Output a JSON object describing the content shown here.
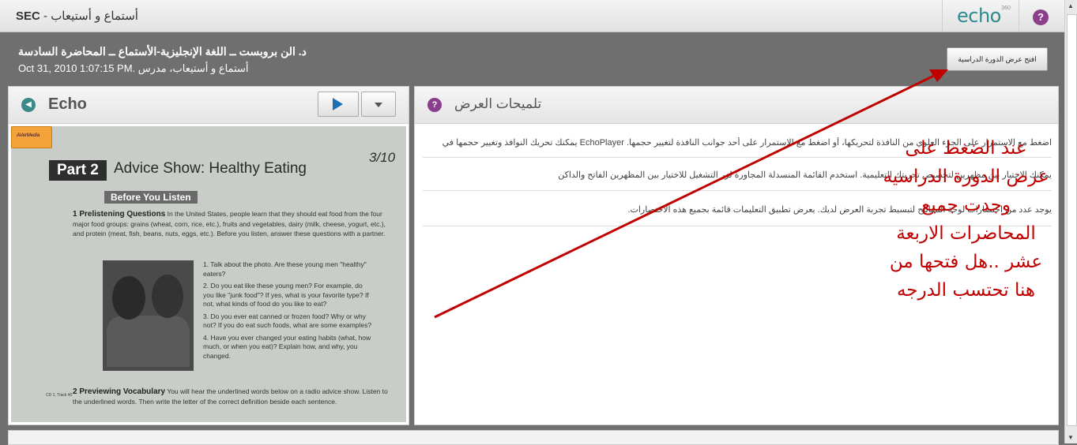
{
  "topbar": {
    "course_code": "SEC",
    "title_rest": " - أستماع و أستيعاب",
    "logo_text": "echo",
    "logo_mark": "360",
    "help_symbol": "?"
  },
  "lecture": {
    "title": "د. الن بروبست ــ اللغة الإنجليزية-الأستماع ــ المحاضرة السادسة",
    "meta": "Oct 31, 2010 1:07:15 PM. أستماع و أستيعاب، مدرس"
  },
  "open_course_button": "افتح عرض الدورة الدراسية",
  "player": {
    "label": "Echo",
    "icon": "echo-logo-icon",
    "play_icon": "play-icon",
    "menu_icon": "chevron-down-icon"
  },
  "video_content": {
    "logo": "AVerMedia",
    "part": "Part 2",
    "part_title": "Advice Show: Healthy Eating",
    "handwriting": "3/10",
    "before_you_listen": "Before You Listen",
    "s1_title": "1 Prelistening Questions",
    "s1_text": "In the United States, people learn that they should eat food from the four major food groups: grains (wheat, corn, rice, etc.), fruits and vegetables, dairy (milk, cheese, yogurt, etc.), and protein (meat, fish, beans, nuts, eggs, etc.). Before you listen, answer these questions with a partner.",
    "questions": [
      "1. Talk about the photo. Are these young men \"healthy\" eaters?",
      "2. Do you eat like these young men? For example, do you like \"junk food\"? If yes, what is your favorite type? If not, what kinds of food do you like to eat?",
      "3. Do you ever eat canned or frozen food? Why or why not? If you do eat such foods, what are some examples?",
      "4. Have you ever changed your eating habits (what, how much, or when you eat)? Explain how, and why, you changed."
    ],
    "s2_title": "2 Previewing Vocabulary",
    "s2_text": "You will hear the underlined words below on a radio advice show. Listen to the underlined words. Then write the letter of the correct definition beside each sentence.",
    "cd_track": "CD 1, Track 40"
  },
  "tips": {
    "title": "تلميحات العرض",
    "icon": "lightbulb-icon",
    "items": [
      "اضغط مع الاستمرار على الجزء العلوي من النافذة لتحريكها، أو اضغط مع الاستمرار على أحد جوانب النافذة لتغيير حجمها. EchoPlayer يمكنك تحريك النوافذ وتغيير حجمها في",
      "يمكنك الاختيار بين مظهرين لتخصيص تجربتك التعليمية. استخدم القائمة المنسدلة المجاورة لزر التشغيل للاختيار بين المظهرين الفاتح والداكن",
      "يوجد عدد من اختصارات لوحة المفاتيح لتبسيط تجربة العرض لديك. يعرض تطبيق التعليمات قائمة بجميع هذه الاختصارات."
    ]
  },
  "annotation": {
    "lines": [
      "عند الضغط على",
      "عرض الدورة الدراسيه",
      "وجدت جميع",
      "المحاضرات الاربعة",
      "عشر ..هل فتحها من",
      "هنا تحتسب الدرجه"
    ],
    "color": "#c00000"
  }
}
